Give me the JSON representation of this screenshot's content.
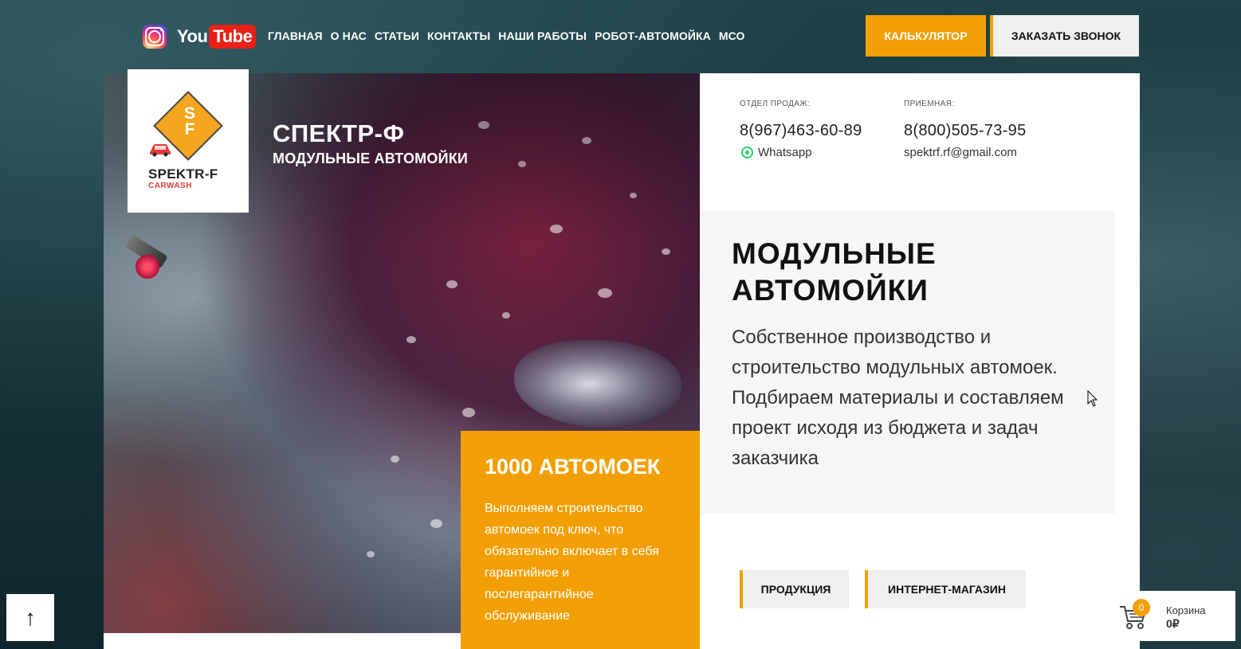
{
  "header": {
    "social": {
      "youtube_you": "You",
      "youtube_tube": "Tube"
    },
    "nav": [
      {
        "label": "ГЛАВНАЯ"
      },
      {
        "label": "О НАС"
      },
      {
        "label": "СТАТЬИ"
      },
      {
        "label": "КОНТАКТЫ"
      },
      {
        "label": "НАШИ РАБОТЫ"
      },
      {
        "label": "РОБОТ-АВТОМОЙКА"
      },
      {
        "label": "МСО"
      }
    ],
    "calc_button": "КАЛЬКУЛЯТОР",
    "call_button": "ЗАКАЗАТЬ ЗВОНОК"
  },
  "logo": {
    "letters_top": "S",
    "letters_bottom": "F",
    "name": "SPEKTR-F",
    "sub": "CARWASH"
  },
  "brand": {
    "title": "СПЕКТР-Ф",
    "subtitle": "МОДУЛЬНЫЕ АВТОМОЙКИ"
  },
  "contacts": {
    "sales_label": "ОТДЕЛ ПРОДАЖ:",
    "sales_phone": "8(967)463-60-89",
    "whatsapp": "Whatsapp",
    "reception_label": "ПРИЕМНАЯ:",
    "reception_phone": "8(800)505-73-95",
    "email": "spektrf.rf@gmail.com"
  },
  "hero": {
    "heading_line1": "МОДУЛЬНЫЕ",
    "heading_line2": "АВТОМОЙКИ",
    "description": "Собственное производство и строительство модульных автомоек. Подбираем материалы и составляем проект исходя из бюджета и задач заказчика"
  },
  "promo_card": {
    "title": "1000 АВТОМОЕК",
    "text": "Выполняем строительство автомоек под ключ, что обязательно включает в себя гарантийное и послегарантийное обслуживание"
  },
  "buttons": {
    "products": "ПРОДУКЦИЯ",
    "shop": "ИНТЕРНЕТ-МАГАЗИН"
  },
  "scroll_top": {
    "symbol": "↑"
  },
  "cart": {
    "count": "0",
    "label": "Корзина",
    "total": "0₽"
  },
  "colors": {
    "accent": "#f29f05",
    "button_bg": "#efefef",
    "panel_grey": "#f6f6f6"
  }
}
